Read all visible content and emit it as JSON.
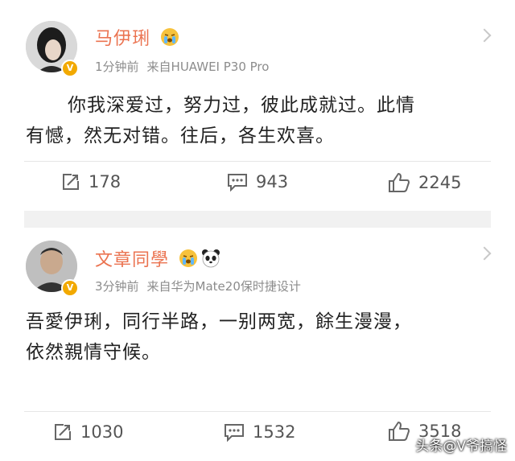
{
  "posts": [
    {
      "username": "马伊琍",
      "time": "1分钟前",
      "source": "来自HUAWEI P30 Pro",
      "content_line1": "你我深爱过，努力过，彼此成就过。此情",
      "content_line2": "有憾，然无对错。往后，各生欢喜。",
      "repost_count": "178",
      "comment_count": "943",
      "like_count": "2245"
    },
    {
      "username": "文章同學",
      "time": "3分钟前",
      "source": "来自华为Mate20保时捷设计",
      "content_line1": "吾愛伊琍，同行半路，一别两宽，餘生漫漫，",
      "content_line2": "依然親情守候。",
      "repost_count": "1030",
      "comment_count": "1532",
      "like_count": "3518"
    }
  ],
  "verified_badge": "V",
  "watermark": "头条@V爷搞怪",
  "colors": {
    "username": "#eb7350",
    "badge": "#f2a900",
    "meta": "#8c8c8c"
  },
  "icons": [
    "repost-icon",
    "comment-icon",
    "like-icon",
    "crying-emoji-icon",
    "panda-emoji-icon",
    "chevron-down-icon"
  ]
}
